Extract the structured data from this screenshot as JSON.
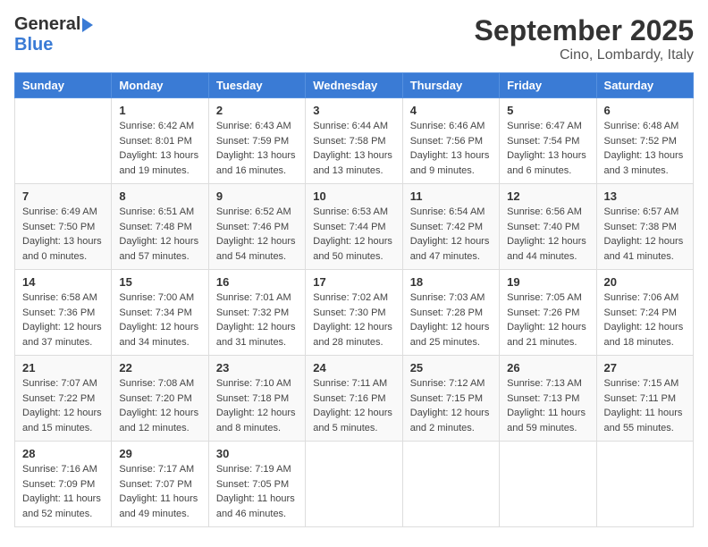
{
  "logo": {
    "general": "General",
    "blue": "Blue"
  },
  "title": "September 2025",
  "subtitle": "Cino, Lombardy, Italy",
  "weekdays": [
    "Sunday",
    "Monday",
    "Tuesday",
    "Wednesday",
    "Thursday",
    "Friday",
    "Saturday"
  ],
  "weeks": [
    [
      {
        "day": "",
        "info": ""
      },
      {
        "day": "1",
        "info": "Sunrise: 6:42 AM\nSunset: 8:01 PM\nDaylight: 13 hours\nand 19 minutes."
      },
      {
        "day": "2",
        "info": "Sunrise: 6:43 AM\nSunset: 7:59 PM\nDaylight: 13 hours\nand 16 minutes."
      },
      {
        "day": "3",
        "info": "Sunrise: 6:44 AM\nSunset: 7:58 PM\nDaylight: 13 hours\nand 13 minutes."
      },
      {
        "day": "4",
        "info": "Sunrise: 6:46 AM\nSunset: 7:56 PM\nDaylight: 13 hours\nand 9 minutes."
      },
      {
        "day": "5",
        "info": "Sunrise: 6:47 AM\nSunset: 7:54 PM\nDaylight: 13 hours\nand 6 minutes."
      },
      {
        "day": "6",
        "info": "Sunrise: 6:48 AM\nSunset: 7:52 PM\nDaylight: 13 hours\nand 3 minutes."
      }
    ],
    [
      {
        "day": "7",
        "info": "Sunrise: 6:49 AM\nSunset: 7:50 PM\nDaylight: 13 hours\nand 0 minutes."
      },
      {
        "day": "8",
        "info": "Sunrise: 6:51 AM\nSunset: 7:48 PM\nDaylight: 12 hours\nand 57 minutes."
      },
      {
        "day": "9",
        "info": "Sunrise: 6:52 AM\nSunset: 7:46 PM\nDaylight: 12 hours\nand 54 minutes."
      },
      {
        "day": "10",
        "info": "Sunrise: 6:53 AM\nSunset: 7:44 PM\nDaylight: 12 hours\nand 50 minutes."
      },
      {
        "day": "11",
        "info": "Sunrise: 6:54 AM\nSunset: 7:42 PM\nDaylight: 12 hours\nand 47 minutes."
      },
      {
        "day": "12",
        "info": "Sunrise: 6:56 AM\nSunset: 7:40 PM\nDaylight: 12 hours\nand 44 minutes."
      },
      {
        "day": "13",
        "info": "Sunrise: 6:57 AM\nSunset: 7:38 PM\nDaylight: 12 hours\nand 41 minutes."
      }
    ],
    [
      {
        "day": "14",
        "info": "Sunrise: 6:58 AM\nSunset: 7:36 PM\nDaylight: 12 hours\nand 37 minutes."
      },
      {
        "day": "15",
        "info": "Sunrise: 7:00 AM\nSunset: 7:34 PM\nDaylight: 12 hours\nand 34 minutes."
      },
      {
        "day": "16",
        "info": "Sunrise: 7:01 AM\nSunset: 7:32 PM\nDaylight: 12 hours\nand 31 minutes."
      },
      {
        "day": "17",
        "info": "Sunrise: 7:02 AM\nSunset: 7:30 PM\nDaylight: 12 hours\nand 28 minutes."
      },
      {
        "day": "18",
        "info": "Sunrise: 7:03 AM\nSunset: 7:28 PM\nDaylight: 12 hours\nand 25 minutes."
      },
      {
        "day": "19",
        "info": "Sunrise: 7:05 AM\nSunset: 7:26 PM\nDaylight: 12 hours\nand 21 minutes."
      },
      {
        "day": "20",
        "info": "Sunrise: 7:06 AM\nSunset: 7:24 PM\nDaylight: 12 hours\nand 18 minutes."
      }
    ],
    [
      {
        "day": "21",
        "info": "Sunrise: 7:07 AM\nSunset: 7:22 PM\nDaylight: 12 hours\nand 15 minutes."
      },
      {
        "day": "22",
        "info": "Sunrise: 7:08 AM\nSunset: 7:20 PM\nDaylight: 12 hours\nand 12 minutes."
      },
      {
        "day": "23",
        "info": "Sunrise: 7:10 AM\nSunset: 7:18 PM\nDaylight: 12 hours\nand 8 minutes."
      },
      {
        "day": "24",
        "info": "Sunrise: 7:11 AM\nSunset: 7:16 PM\nDaylight: 12 hours\nand 5 minutes."
      },
      {
        "day": "25",
        "info": "Sunrise: 7:12 AM\nSunset: 7:15 PM\nDaylight: 12 hours\nand 2 minutes."
      },
      {
        "day": "26",
        "info": "Sunrise: 7:13 AM\nSunset: 7:13 PM\nDaylight: 11 hours\nand 59 minutes."
      },
      {
        "day": "27",
        "info": "Sunrise: 7:15 AM\nSunset: 7:11 PM\nDaylight: 11 hours\nand 55 minutes."
      }
    ],
    [
      {
        "day": "28",
        "info": "Sunrise: 7:16 AM\nSunset: 7:09 PM\nDaylight: 11 hours\nand 52 minutes."
      },
      {
        "day": "29",
        "info": "Sunrise: 7:17 AM\nSunset: 7:07 PM\nDaylight: 11 hours\nand 49 minutes."
      },
      {
        "day": "30",
        "info": "Sunrise: 7:19 AM\nSunset: 7:05 PM\nDaylight: 11 hours\nand 46 minutes."
      },
      {
        "day": "",
        "info": ""
      },
      {
        "day": "",
        "info": ""
      },
      {
        "day": "",
        "info": ""
      },
      {
        "day": "",
        "info": ""
      }
    ]
  ]
}
